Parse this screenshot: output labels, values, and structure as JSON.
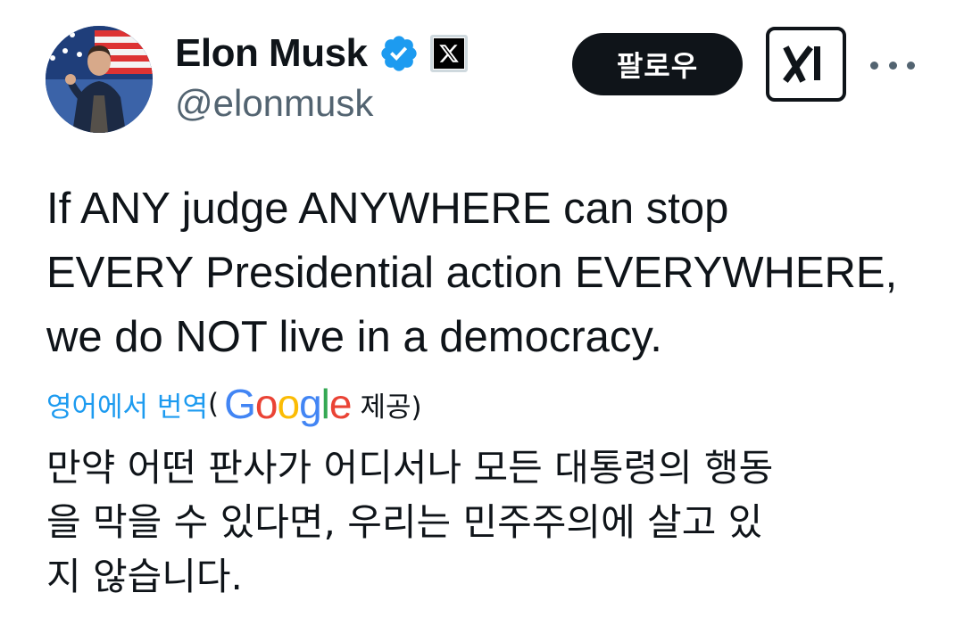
{
  "author": {
    "name": "Elon Musk",
    "handle": "@elonmusk",
    "verified_icon": "verified-badge-icon",
    "affiliation_icon": "x-logo-icon",
    "colors": {
      "verified": "#1d9bf0"
    }
  },
  "actions": {
    "follow_label": "팔로우",
    "grok_icon": "grok-xai-icon",
    "more_icon": "more-options-icon"
  },
  "tweet": {
    "text": "If ANY judge ANYWHERE can stop\nEVERY Presidential action EVERYWHERE,\nwe do NOT live in a democracy."
  },
  "translation": {
    "link_label": "영어에서 번역",
    "open_paren": "(",
    "provider_parts": [
      "G",
      "o",
      "o",
      "g",
      "l",
      "e"
    ],
    "provided_label": "제공)",
    "text": "만약 어떤 판사가 어디서나 모든 대통령의 행동\n을 막을 수 있다면, 우리는 민주주의에 살고 있\n지 않습니다.",
    "colors": {
      "link": "#1d9bf0"
    }
  }
}
